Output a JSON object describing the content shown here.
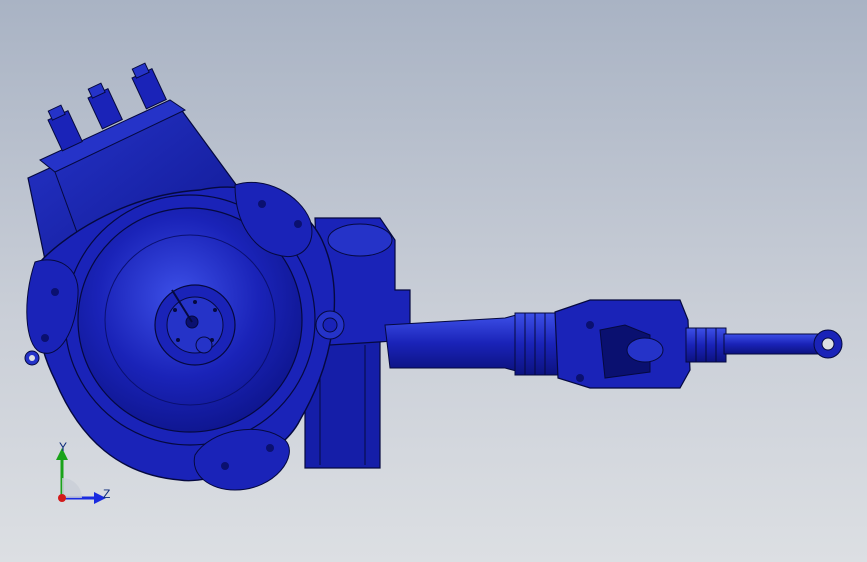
{
  "viewport": {
    "background_top": "#a9b3c4",
    "background_bottom": "#dcdfe3"
  },
  "model": {
    "body_color": "#1a23b8",
    "edge_color": "#05093f",
    "highlight_color": "#3d50e8"
  },
  "triad": {
    "y_label": "Y",
    "z_label": "Z",
    "y_axis_color": "#1aa31a",
    "z_axis_color": "#1a2be0",
    "origin_color": "#d21a1a"
  }
}
